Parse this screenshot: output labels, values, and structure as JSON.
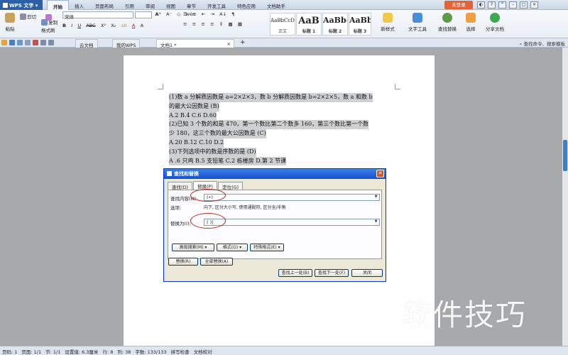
{
  "app": {
    "name": "WPS 文字",
    "login": "未登录"
  },
  "menu": [
    "开始",
    "插入",
    "页面布局",
    "引用",
    "审阅",
    "视图",
    "章节",
    "开发工具",
    "特色应用",
    "文档助手"
  ],
  "ribbon": {
    "paste": "粘贴",
    "cut": "剪切",
    "copy": "复制",
    "format_painter": "格式刷",
    "font_name": "宋体",
    "font_size": "",
    "styles": [
      {
        "sample": "AaBbCcD",
        "name": "正文"
      },
      {
        "sample": "AaB",
        "name": "标题 1"
      },
      {
        "sample": "AaBb(",
        "name": "标题 2"
      },
      {
        "sample": "AaBb",
        "name": "标题 3"
      }
    ],
    "new_style": "新样式",
    "text_tools": "文字工具",
    "find_replace": "查找替换",
    "select": "选择",
    "share": "分享文档"
  },
  "tabs": [
    "云文档",
    "我的WPS",
    "文档1 *"
  ],
  "search_cmd": "查找命令、搜索模板",
  "document": {
    "lines": [
      "(1)数 a 分解质因数是 a=2×2×3，数 b 分解质因数是 b=2×2×5，数 a 和数 b",
      "的最大公因数是 (B)",
      "A.2  B.4  C.6  D.60",
      "(2)已知 3 个数的和是 470，第一个数比第二个数多 160，第三个数比第一个数",
      "少 180，这三个数的最大公因数是 (C)",
      "A.20  B.12  C.10  D.2",
      "(3)下列选项中的数是序数的是 (D)",
      "A .6 只鸡    B.5 支铅笔     C.2 栋楼房     D.第 2 节课"
    ]
  },
  "dialog": {
    "title": "查找和替换",
    "close": "✕",
    "tabs": [
      "查找(D)",
      "替换(P)",
      "定位(G)"
    ],
    "find_label": "查找内容(N):",
    "find_value": "(•)",
    "options_label": "选项:",
    "options_value": "向下, 区分大小写, 使用通配符, 区分全/半角",
    "replace_label": "替换为(I):",
    "replace_value": "( )|",
    "advanced": "高级搜索(M) ▾",
    "format": "格式(O) ▾",
    "special": "特殊格式(E) ▾",
    "replace_btn": "替换(R)",
    "replace_all_btn": "全部替换(A)",
    "find_prev": "查找上一处(B)",
    "find_next": "查找下一处(F)",
    "close_btn": "关闭"
  },
  "watermark": "软件技巧",
  "status": [
    "页码: 1",
    "页面: 1/1",
    "节: 1/1",
    "设置值: 6.3厘米",
    "行: 8",
    "列: 38",
    "字数: 133/133",
    "拼写检查",
    "文档校对"
  ]
}
